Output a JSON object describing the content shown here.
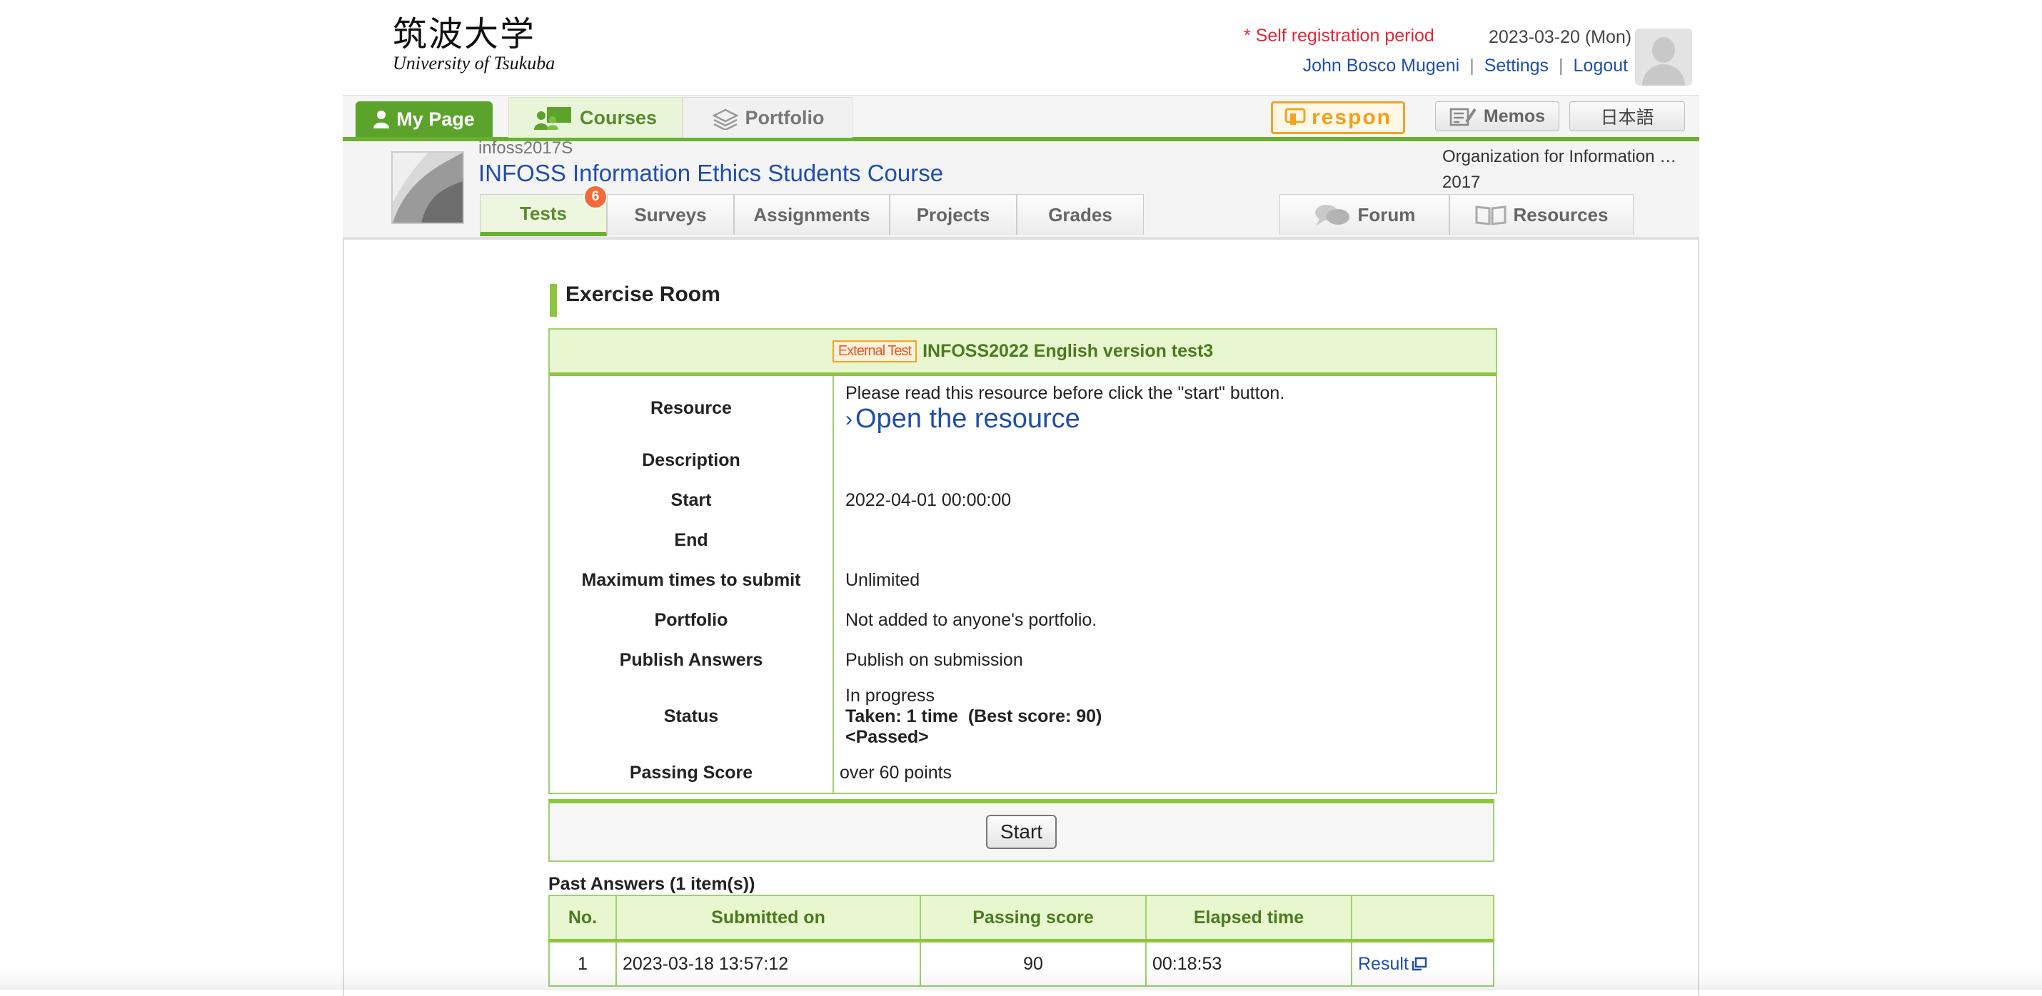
{
  "header": {
    "logo_kanji": "筑波大学",
    "logo_en": "University of Tsukuba",
    "self_registration": "* Self registration period",
    "date": "2023-03-20 (Mon)",
    "user_name": "John Bosco Mugeni",
    "settings": "Settings",
    "logout": "Logout",
    "sep": "|"
  },
  "nav": {
    "my_page": "My Page",
    "courses": "Courses",
    "portfolio": "Portfolio",
    "respon": "respon",
    "memos": "Memos",
    "language": "日本語"
  },
  "course": {
    "code": "infoss2017S",
    "title": "INFOSS Information Ethics Students Course",
    "organization_line1": "Organization for Information …",
    "organization_line2": "2017",
    "tabs": {
      "tests": "Tests",
      "tests_badge": "6",
      "surveys": "Surveys",
      "assignments": "Assignments",
      "projects": "Projects",
      "grades": "Grades",
      "forum": "Forum",
      "resources": "Resources"
    }
  },
  "section_title": "Exercise Room",
  "test": {
    "tag": "External Test",
    "name": "INFOSS2022 English version test3",
    "rows": {
      "resource_label": "Resource",
      "resource_note": "Please read this resource before click the \"start\" button.",
      "resource_link": "Open the resource",
      "description_label": "Description",
      "start_label": "Start",
      "start_value": "2022-04-01 00:00:00",
      "end_label": "End",
      "max_label": "Maximum times to submit",
      "max_value": "Unlimited",
      "portfolio_label": "Portfolio",
      "portfolio_value": "Not added to anyone's portfolio.",
      "publish_label": "Publish Answers",
      "publish_value": "Publish on submission",
      "status_label": "Status",
      "status_line1": "In progress",
      "status_line2": "Taken: 1 time  (Best score: 90)",
      "status_line3": "<Passed>",
      "passing_label": "Passing Score",
      "passing_value": "over 60 points"
    },
    "start_button": "Start"
  },
  "past_answers": {
    "title": "Past Answers (1 item(s))",
    "headers": [
      "No.",
      "Submitted on",
      "Passing score",
      "Elapsed time",
      ""
    ],
    "rows": [
      {
        "no": "1",
        "submitted": "2023-03-18 13:57:12",
        "score": "90",
        "elapsed": "00:18:53",
        "link": "Result"
      }
    ]
  },
  "colors": {
    "accent_green": "#6cb033",
    "link_blue": "#1f4fa8",
    "alert_red": "#e0293a"
  }
}
